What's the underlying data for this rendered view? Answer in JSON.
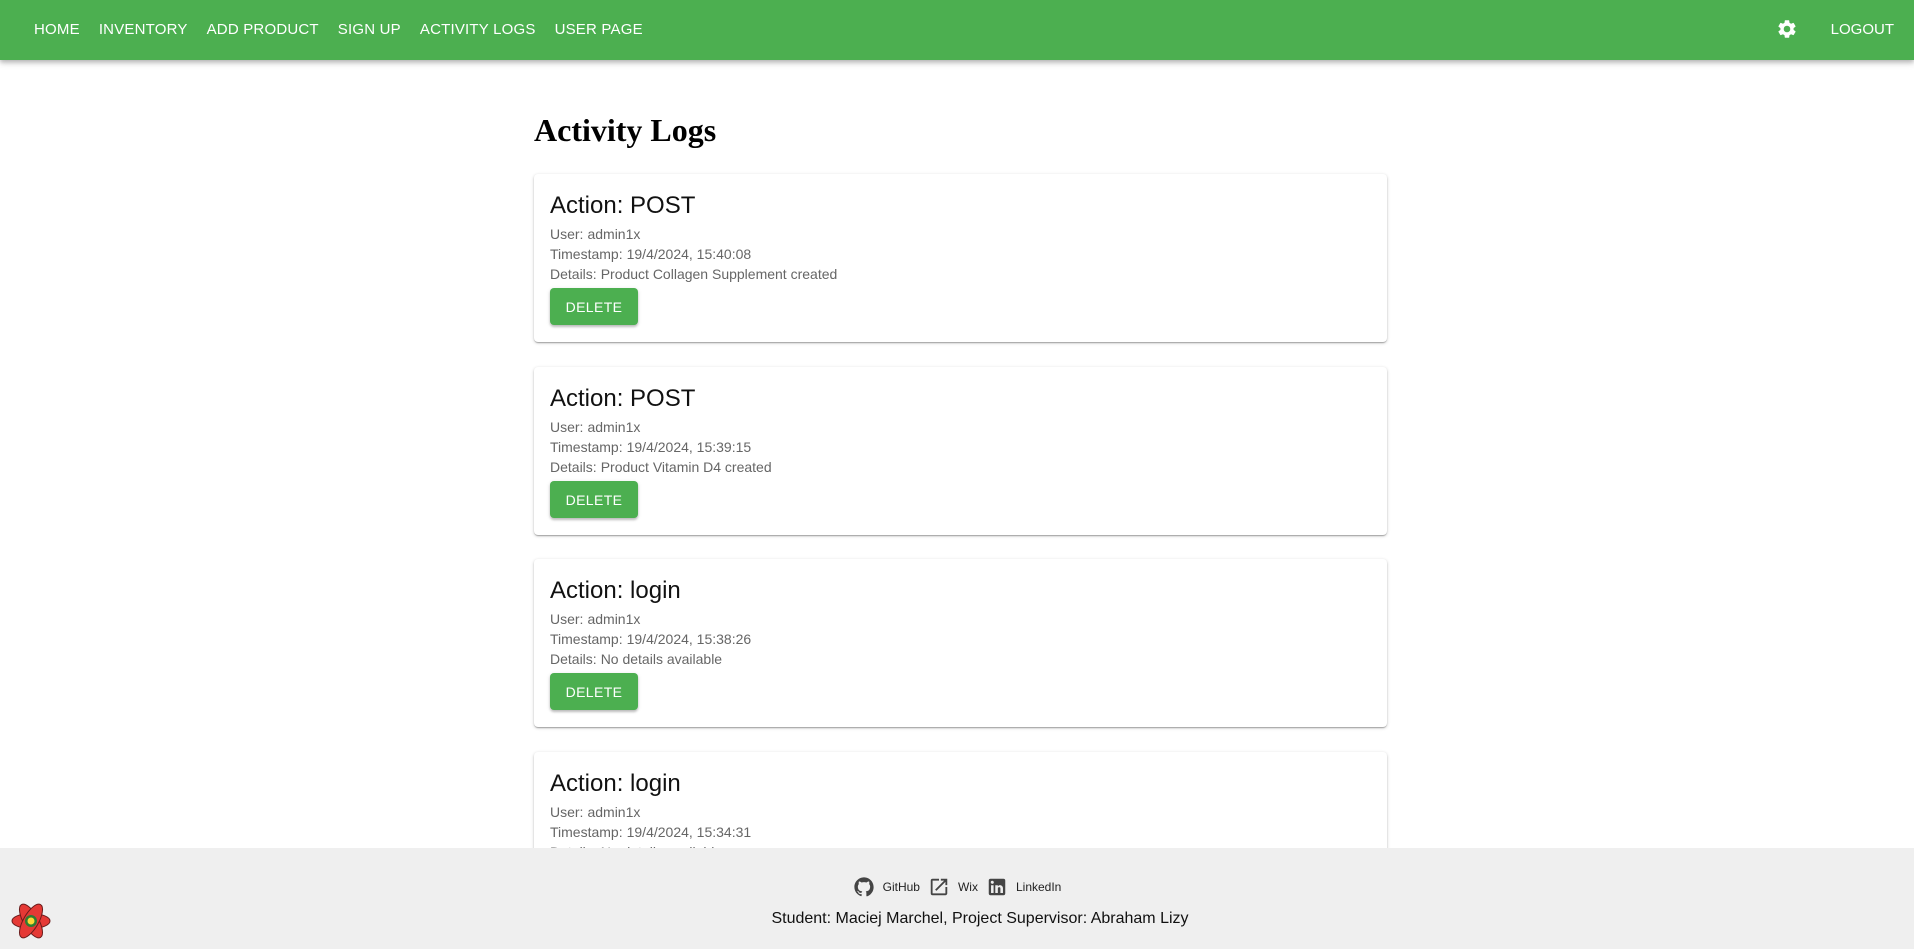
{
  "nav": {
    "items": [
      "HOME",
      "INVENTORY",
      "ADD PRODUCT",
      "SIGN UP",
      "ACTIVITY LOGS",
      "USER PAGE"
    ],
    "settings_icon": "gear-icon",
    "logout": "LOGOUT",
    "color": "#4caf50"
  },
  "page": {
    "title": "Activity Logs"
  },
  "labels": {
    "action": "Action:",
    "user": "User:",
    "timestamp": "Timestamp:",
    "details": "Details:",
    "delete": "DELETE"
  },
  "logs": [
    {
      "action": "POST",
      "user": "admin1x",
      "timestamp": "19/4/2024, 15:40:08",
      "details": "Product Collagen Supplement created"
    },
    {
      "action": "POST",
      "user": "admin1x",
      "timestamp": "19/4/2024, 15:39:15",
      "details": "Product Vitamin D4 created"
    },
    {
      "action": "login",
      "user": "admin1x",
      "timestamp": "19/4/2024, 15:38:26",
      "details": "No details available"
    },
    {
      "action": "login",
      "user": "admin1x",
      "timestamp": "19/4/2024, 15:34:31",
      "details": "No details available"
    }
  ],
  "footer": {
    "links": [
      {
        "label": "GitHub",
        "icon": "github-icon"
      },
      {
        "label": "Wix",
        "icon": "external-link-icon"
      },
      {
        "label": "LinkedIn",
        "icon": "linkedin-icon"
      }
    ],
    "credit": "Student: Maciej Marchel, Project Supervisor: Abraham Lizy",
    "logo_icon": "react-logo-icon"
  }
}
